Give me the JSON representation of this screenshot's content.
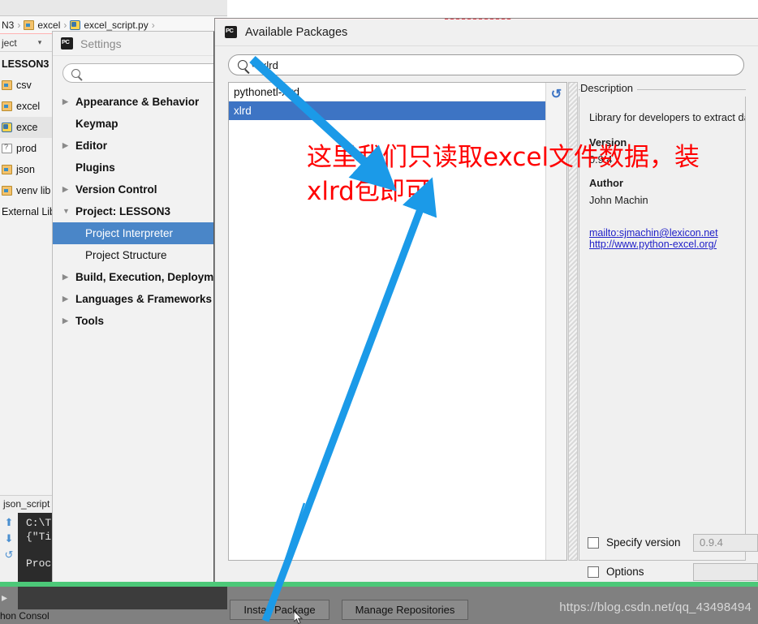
{
  "ide": {
    "breadcrumb": [
      {
        "label": "N3",
        "icon": "none"
      },
      {
        "label": "excel",
        "icon": "folder-icon"
      },
      {
        "label": "excel_script.py",
        "icon": "python-file-icon"
      }
    ],
    "project_toolbar": {
      "label": "ject",
      "caret": "▾"
    },
    "tree": [
      {
        "label": "LESSON3",
        "icon": "none",
        "bold": true,
        "indent": 0
      },
      {
        "label": "csv",
        "icon": "folder-icon",
        "bold": false,
        "indent": 1
      },
      {
        "label": "excel",
        "icon": "folder-icon",
        "bold": false,
        "indent": 1
      },
      {
        "label": "exce",
        "icon": "python-file-icon",
        "bold": false,
        "indent": 2,
        "selected": true
      },
      {
        "label": "prod",
        "icon": "unknown-file-icon",
        "bold": false,
        "indent": 2
      },
      {
        "label": "json",
        "icon": "folder-icon",
        "bold": false,
        "indent": 1
      },
      {
        "label": "venv  lib",
        "icon": "folder-icon",
        "bold": false,
        "indent": 1
      },
      {
        "label": "External Lib",
        "icon": "none",
        "bold": false,
        "indent": 0
      }
    ],
    "console": {
      "tab_label": "json_script",
      "lines": [
        "C:\\T",
        "{\"Ti",
        "Proc"
      ],
      "footer_tab": "hon Consol",
      "gutter_icons": [
        "arrow-up-icon",
        "arrow-down-icon",
        "rerun-icon"
      ]
    },
    "watermark": "https://blog.csdn.net/qq_43498494"
  },
  "settings": {
    "title": "Settings",
    "search_value": "",
    "search_placeholder": "",
    "tree": [
      {
        "label": "Appearance & Behavior",
        "expandable": true,
        "expanded": false,
        "bold": true,
        "child": false
      },
      {
        "label": "Keymap",
        "expandable": false,
        "expanded": false,
        "bold": true,
        "child": false
      },
      {
        "label": "Editor",
        "expandable": true,
        "expanded": false,
        "bold": true,
        "child": false
      },
      {
        "label": "Plugins",
        "expandable": false,
        "expanded": false,
        "bold": true,
        "child": false
      },
      {
        "label": "Version Control",
        "expandable": true,
        "expanded": false,
        "bold": true,
        "child": false
      },
      {
        "label": "Project: LESSON3",
        "expandable": true,
        "expanded": true,
        "bold": true,
        "child": false
      },
      {
        "label": "Project Interpreter",
        "expandable": false,
        "expanded": false,
        "bold": false,
        "child": true,
        "selected": true
      },
      {
        "label": "Project Structure",
        "expandable": false,
        "expanded": false,
        "bold": false,
        "child": true
      },
      {
        "label": "Build, Execution, Deploym",
        "expandable": true,
        "expanded": false,
        "bold": true,
        "child": false
      },
      {
        "label": "Languages & Frameworks",
        "expandable": true,
        "expanded": false,
        "bold": true,
        "child": false
      },
      {
        "label": "Tools",
        "expandable": true,
        "expanded": false,
        "bold": true,
        "child": false
      }
    ]
  },
  "available_packages": {
    "title": "Available Packages",
    "search_value": "xlrd",
    "search_placeholder": "",
    "packages": [
      {
        "name": "pythonetl-xlrd",
        "selected": false
      },
      {
        "name": "xlrd",
        "selected": true
      }
    ],
    "refresh_icon": "refresh-icon",
    "description": {
      "legend": "Description",
      "summary": "Library for developers to extract dat",
      "version_label": "Version",
      "version_value": "0.9.4",
      "author_label": "Author",
      "author_value": "John Machin",
      "links": [
        "mailto:sjmachin@lexicon.net",
        "http://www.python-excel.org/"
      ]
    },
    "options": {
      "specify_version_label": "Specify version",
      "specify_version_value": "0.9.4",
      "specify_version_checked": false,
      "options_label": "Options",
      "options_value": "",
      "options_checked": false
    },
    "buttons": {
      "install": "Install Package",
      "manage": "Manage Repositories"
    }
  },
  "annotation": {
    "text": "这里我们只读取excel文件数据，装\nxlrd包即可",
    "color": "#ff0000",
    "arrow_color": "#1b9ae8"
  }
}
